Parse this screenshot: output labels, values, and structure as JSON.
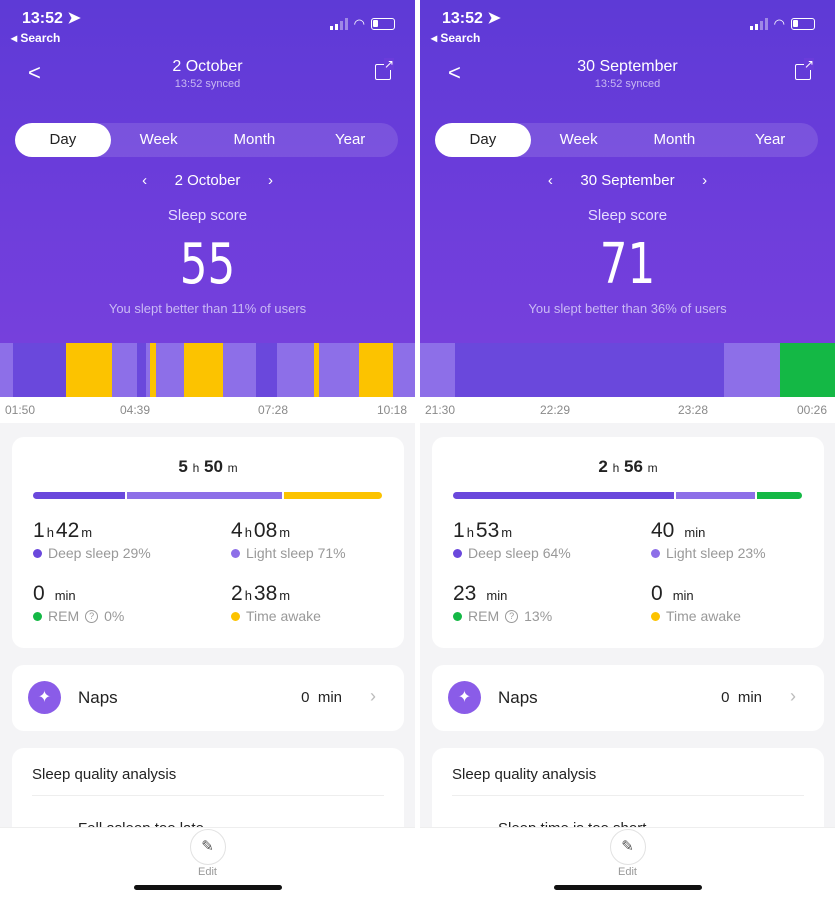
{
  "colors": {
    "deep": "#6a48dc",
    "light": "#8d6fe8",
    "awake": "#fcc300",
    "rem": "#14b845",
    "header": "#6a3cda"
  },
  "panels": [
    {
      "status": {
        "time": "13:52",
        "back": "◂ Search"
      },
      "header": {
        "title": "2 October",
        "synced": "13:52 synced"
      },
      "tabs": [
        "Day",
        "Week",
        "Month",
        "Year"
      ],
      "active_tab": "Day",
      "date_nav": "2 October",
      "score_label": "Sleep score",
      "score": "55",
      "comparison": "You slept better than 11% of users",
      "timeline": [
        [
          "light",
          13
        ],
        [
          "deep",
          53
        ],
        [
          "awake",
          46
        ],
        [
          "light",
          25
        ],
        [
          "deep",
          9
        ],
        [
          "light",
          4
        ],
        [
          "awake",
          6
        ],
        [
          "light",
          28
        ],
        [
          "awake",
          39
        ],
        [
          "light",
          33
        ],
        [
          "deep",
          21
        ],
        [
          "light",
          37
        ],
        [
          "awake",
          5
        ],
        [
          "light",
          40
        ],
        [
          "awake",
          34
        ],
        [
          "light",
          22
        ]
      ],
      "time_ticks": [
        "01:50",
        "04:39",
        "07:28",
        "10:18"
      ],
      "total": {
        "h": "5",
        "m": "50"
      },
      "proportions": [
        [
          "deep",
          29
        ],
        [
          "light",
          49
        ],
        [
          "awake",
          31
        ]
      ],
      "stats": [
        {
          "h": "1",
          "m": "42",
          "unit": "",
          "label": "Deep sleep 29%",
          "type": "deep"
        },
        {
          "h": "4",
          "m": "08",
          "unit": "",
          "label": "Light sleep 71%",
          "type": "light"
        },
        {
          "h": "",
          "m": "0",
          "unit": "min",
          "label": "REM",
          "pct": "0%",
          "type": "rem"
        },
        {
          "h": "2",
          "m": "38",
          "unit": "",
          "label": "Time awake",
          "type": "awake"
        }
      ],
      "naps": {
        "label": "Naps",
        "value": "0",
        "unit": "min"
      },
      "analysis": {
        "title": "Sleep quality analysis",
        "first_item": "Fell asleep too late"
      },
      "footer": {
        "edit": "Edit"
      }
    },
    {
      "status": {
        "time": "13:52",
        "back": "◂ Search"
      },
      "header": {
        "title": "30 September",
        "synced": "13:52 synced"
      },
      "tabs": [
        "Day",
        "Week",
        "Month",
        "Year"
      ],
      "active_tab": "Day",
      "date_nav": "30 September",
      "score_label": "Sleep score",
      "score": "71",
      "comparison": "You slept better than 36% of users",
      "timeline": [
        [
          "light",
          35
        ],
        [
          "deep",
          266
        ],
        [
          "light",
          56
        ],
        [
          "rem",
          54
        ]
      ],
      "time_ticks": [
        "21:30",
        "22:29",
        "23:28",
        "00:26"
      ],
      "total": {
        "h": "2",
        "m": "56"
      },
      "proportions": [
        [
          "deep",
          64
        ],
        [
          "light",
          23
        ],
        [
          "rem",
          13
        ]
      ],
      "stats": [
        {
          "h": "1",
          "m": "53",
          "unit": "",
          "label": "Deep sleep 64%",
          "type": "deep"
        },
        {
          "h": "",
          "m": "40",
          "unit": "min",
          "label": "Light sleep 23%",
          "type": "light"
        },
        {
          "h": "",
          "m": "23",
          "unit": "min",
          "label": "REM",
          "pct": "13%",
          "type": "rem"
        },
        {
          "h": "",
          "m": "0",
          "unit": "min",
          "label": "Time awake",
          "type": "awake"
        }
      ],
      "naps": {
        "label": "Naps",
        "value": "0",
        "unit": "min"
      },
      "analysis": {
        "title": "Sleep quality analysis",
        "first_item": "Sleep time is too short"
      },
      "footer": {
        "edit": "Edit"
      }
    }
  ]
}
